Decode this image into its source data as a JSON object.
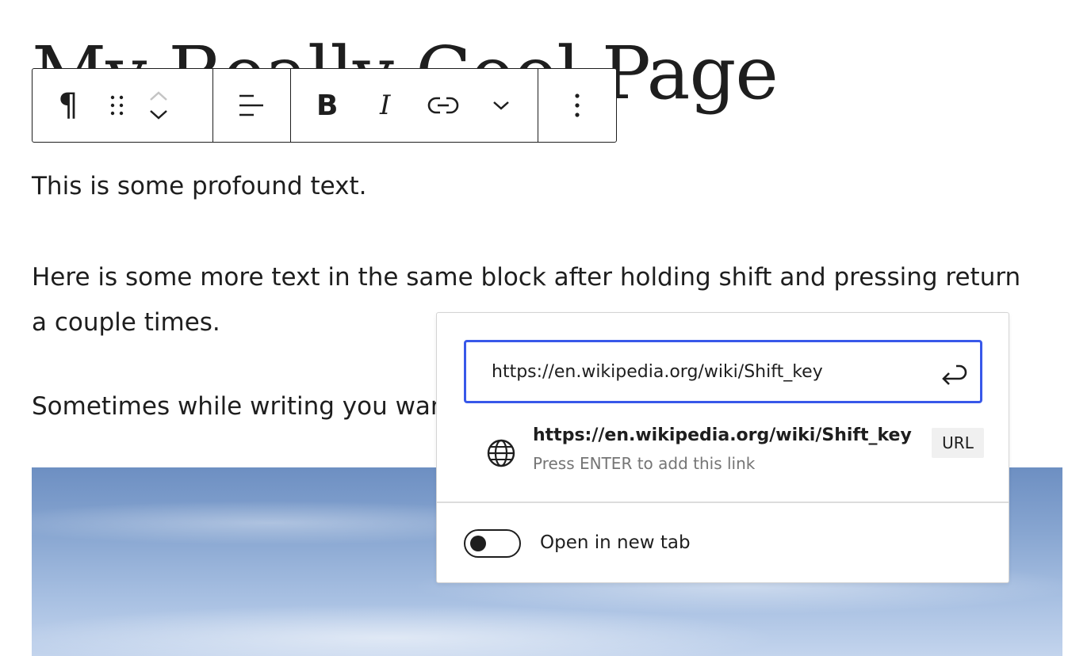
{
  "post": {
    "title": "My Really Cool Page",
    "paragraphs": [
      "This is some profound text.",
      "Here is some more text in the same block after holding shift and pressing return a couple times.",
      "Sometimes while writing you want to link to something."
    ]
  },
  "toolbar": {
    "paragraph_icon": "¶",
    "bold_label": "B",
    "italic_label": "I",
    "icons": [
      "paragraph-icon",
      "drag-handle-icon",
      "chevron-up-icon",
      "chevron-down-icon",
      "align-left-icon",
      "link-icon",
      "chevron-down-icon",
      "more-vertical-icon"
    ]
  },
  "link_popover": {
    "url_value": "https://en.wikipedia.org/wiki/Shift_key",
    "suggestion": {
      "url": "https://en.wikipedia.org/wiki/Shift_key",
      "hint": "Press ENTER to add this link",
      "badge": "URL"
    },
    "new_tab_label": "Open in new tab",
    "new_tab_enabled": false,
    "accent_color": "#3858e9"
  }
}
